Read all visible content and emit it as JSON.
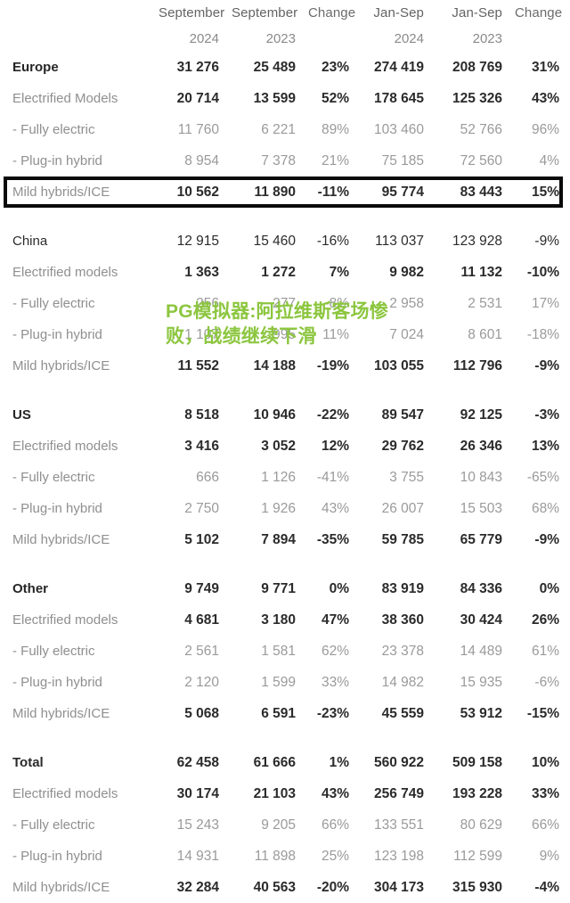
{
  "table": {
    "header": {
      "label_col": "",
      "columns": [
        {
          "line1": "September",
          "line2": "2024"
        },
        {
          "line1": "September",
          "line2": "2023"
        },
        {
          "line1": "Change",
          "line2": ""
        },
        {
          "line1": "Jan-Sep",
          "line2": "2024"
        },
        {
          "line1": "Jan-Sep",
          "line2": "2023"
        },
        {
          "line1": "Change",
          "line2": ""
        }
      ]
    },
    "blocks": [
      {
        "name": "europe",
        "rows": [
          {
            "label": "Europe",
            "style": "region-head",
            "sep2024": "31 276",
            "sep2023": "25 489",
            "chg1": "23%",
            "jan2024": "274 419",
            "jan2023": "208 769",
            "chg2": "31%"
          },
          {
            "label": "Electrified Models",
            "style": "electrified",
            "sep2024": "20 714",
            "sep2023": "13 599",
            "chg1": "52%",
            "jan2024": "178 645",
            "jan2023": "125 326",
            "chg2": "43%"
          },
          {
            "label": "- Fully electric",
            "style": "sub",
            "sep2024": "11 760",
            "sep2023": "6 221",
            "chg1": "89%",
            "jan2024": "103 460",
            "jan2023": "52 766",
            "chg2": "96%"
          },
          {
            "label": "- Plug-in hybrid",
            "style": "sub",
            "sep2024": "8 954",
            "sep2023": "7 378",
            "chg1": "21%",
            "jan2024": "75 185",
            "jan2023": "72 560",
            "chg2": "4%"
          },
          {
            "label": "Mild hybrids/ICE",
            "style": "mild",
            "sep2024": "10 562",
            "sep2023": "11 890",
            "chg1": "-11%",
            "jan2024": "95 774",
            "jan2023": "83 443",
            "chg2": "15%"
          }
        ]
      },
      {
        "name": "china",
        "rows": [
          {
            "label": "China",
            "style": "boxed",
            "sep2024": "12 915",
            "sep2023": "15 460",
            "chg1": "-16%",
            "jan2024": "113 037",
            "jan2023": "123 928",
            "chg2": "-9%"
          },
          {
            "label": "Electrified models",
            "style": "electrified",
            "sep2024": "1 363",
            "sep2023": "1 272",
            "chg1": "7%",
            "jan2024": "9 982",
            "jan2023": "11 132",
            "chg2": "-10%"
          },
          {
            "label": "- Fully electric",
            "style": "sub",
            "sep2024": "256",
            "sep2023": "277",
            "chg1": "-8%",
            "jan2024": "2 958",
            "jan2023": "2 531",
            "chg2": "17%"
          },
          {
            "label": "- Plug-in hybrid",
            "style": "sub",
            "sep2024": "1 107",
            "sep2023": "995",
            "chg1": "11%",
            "jan2024": "7 024",
            "jan2023": "8 601",
            "chg2": "-18%"
          },
          {
            "label": "Mild hybrids/ICE",
            "style": "mild",
            "sep2024": "11 552",
            "sep2023": "14 188",
            "chg1": "-19%",
            "jan2024": "103 055",
            "jan2023": "112 796",
            "chg2": "-9%"
          }
        ]
      },
      {
        "name": "us",
        "rows": [
          {
            "label": "US",
            "style": "region-head",
            "sep2024": "8 518",
            "sep2023": "10 946",
            "chg1": "-22%",
            "jan2024": "89 547",
            "jan2023": "92 125",
            "chg2": "-3%"
          },
          {
            "label": "Electrified models",
            "style": "electrified",
            "sep2024": "3 416",
            "sep2023": "3 052",
            "chg1": "12%",
            "jan2024": "29 762",
            "jan2023": "26 346",
            "chg2": "13%"
          },
          {
            "label": "- Fully electric",
            "style": "sub",
            "sep2024": "666",
            "sep2023": "1 126",
            "chg1": "-41%",
            "jan2024": "3 755",
            "jan2023": "10 843",
            "chg2": "-65%"
          },
          {
            "label": "- Plug-in hybrid",
            "style": "sub",
            "sep2024": "2 750",
            "sep2023": "1 926",
            "chg1": "43%",
            "jan2024": "26 007",
            "jan2023": "15 503",
            "chg2": "68%"
          },
          {
            "label": "Mild hybrids/ICE",
            "style": "mild",
            "sep2024": "5 102",
            "sep2023": "7 894",
            "chg1": "-35%",
            "jan2024": "59 785",
            "jan2023": "65 779",
            "chg2": "-9%"
          }
        ]
      },
      {
        "name": "other",
        "rows": [
          {
            "label": "Other",
            "style": "region-head",
            "sep2024": "9 749",
            "sep2023": "9 771",
            "chg1": "0%",
            "jan2024": "83 919",
            "jan2023": "84 336",
            "chg2": "0%"
          },
          {
            "label": "Electrified models",
            "style": "electrified",
            "sep2024": "4 681",
            "sep2023": "3 180",
            "chg1": "47%",
            "jan2024": "38 360",
            "jan2023": "30 424",
            "chg2": "26%"
          },
          {
            "label": "- Fully electric",
            "style": "sub",
            "sep2024": "2 561",
            "sep2023": "1 581",
            "chg1": "62%",
            "jan2024": "23 378",
            "jan2023": "14 489",
            "chg2": "61%"
          },
          {
            "label": "- Plug-in hybrid",
            "style": "sub",
            "sep2024": "2 120",
            "sep2023": "1 599",
            "chg1": "33%",
            "jan2024": "14 982",
            "jan2023": "15 935",
            "chg2": "-6%"
          },
          {
            "label": "Mild hybrids/ICE",
            "style": "mild",
            "sep2024": "5 068",
            "sep2023": "6 591",
            "chg1": "-23%",
            "jan2024": "45 559",
            "jan2023": "53 912",
            "chg2": "-15%"
          }
        ]
      },
      {
        "name": "total",
        "rows": [
          {
            "label": "Total",
            "style": "total-head",
            "sep2024": "62 458",
            "sep2023": "61 666",
            "chg1": "1%",
            "jan2024": "560 922",
            "jan2023": "509 158",
            "chg2": "10%"
          },
          {
            "label": "Electrified models",
            "style": "electrified",
            "sep2024": "30 174",
            "sep2023": "21 103",
            "chg1": "43%",
            "jan2024": "256 749",
            "jan2023": "193 228",
            "chg2": "33%"
          },
          {
            "label": "- Fully electric",
            "style": "sub",
            "sep2024": "15 243",
            "sep2023": "9 205",
            "chg1": "66%",
            "jan2024": "133 551",
            "jan2023": "80 629",
            "chg2": "66%"
          },
          {
            "label": "- Plug-in hybrid",
            "style": "sub",
            "sep2024": "14 931",
            "sep2023": "11 898",
            "chg1": "25%",
            "jan2024": "123 198",
            "jan2023": "112 599",
            "chg2": "9%"
          },
          {
            "label": "Mild hybrids/ICE",
            "style": "mild",
            "sep2024": "32 284",
            "sep2023": "40 563",
            "chg1": "-20%",
            "jan2024": "304 173",
            "jan2023": "315 930",
            "chg2": "-4%"
          }
        ]
      }
    ]
  },
  "watermark": {
    "text": "PG模拟器:阿拉维斯客场惨败，战绩继续下滑",
    "color": "#8CC63F"
  },
  "highlight": {
    "row_name": "China",
    "border_color": "#0a0a0a"
  }
}
